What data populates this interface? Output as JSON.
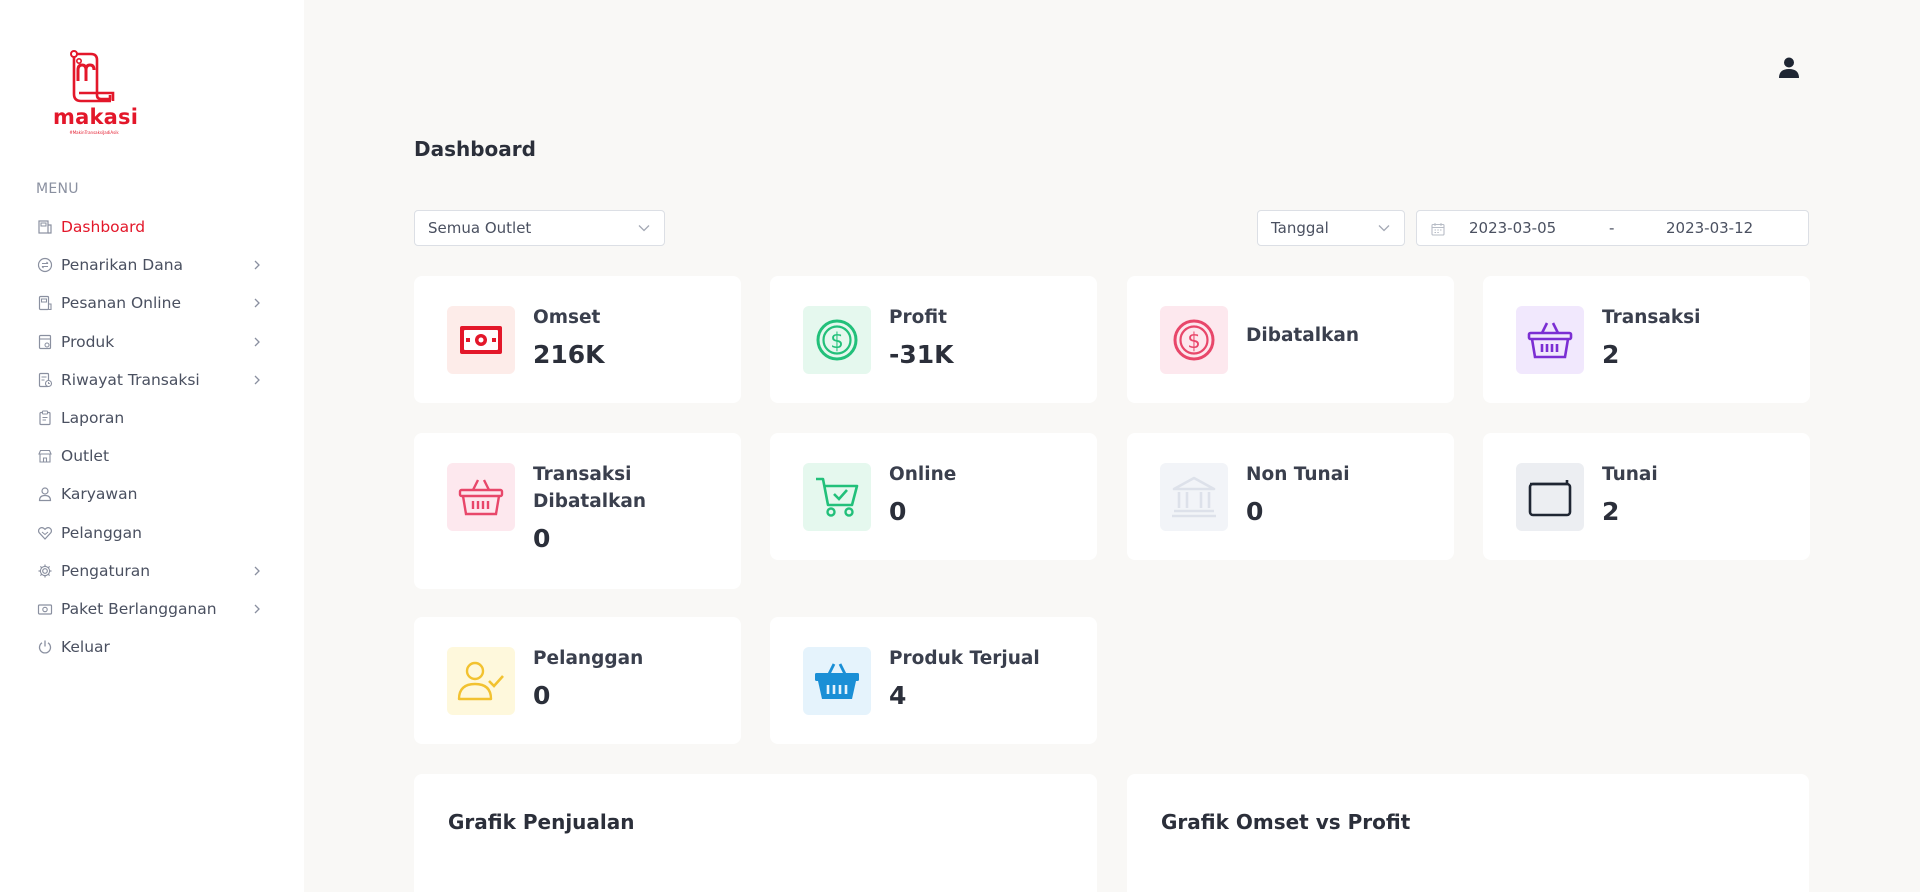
{
  "brand": {
    "name": "makasi",
    "tagline": "#MakinTransaksiJadiAsik",
    "color": "#e3172a"
  },
  "sidebar": {
    "menu_title": "MENU",
    "items": [
      {
        "label": "Dashboard",
        "icon": "dashboard-icon",
        "active": true,
        "has_submenu": false
      },
      {
        "label": "Penarikan Dana",
        "icon": "transfer-icon",
        "has_submenu": true
      },
      {
        "label": "Pesanan Online",
        "icon": "online-order-icon",
        "has_submenu": true
      },
      {
        "label": "Produk",
        "icon": "product-icon",
        "has_submenu": true
      },
      {
        "label": "Riwayat Transaksi",
        "icon": "history-icon",
        "has_submenu": true
      },
      {
        "label": "Laporan",
        "icon": "report-icon",
        "has_submenu": false
      },
      {
        "label": "Outlet",
        "icon": "store-icon",
        "has_submenu": false
      },
      {
        "label": "Karyawan",
        "icon": "employee-icon",
        "has_submenu": false
      },
      {
        "label": "Pelanggan",
        "icon": "customer-icon",
        "has_submenu": false
      },
      {
        "label": "Pengaturan",
        "icon": "settings-icon",
        "has_submenu": true
      },
      {
        "label": "Paket Berlangganan",
        "icon": "subscription-icon",
        "has_submenu": true
      },
      {
        "label": "Keluar",
        "icon": "power-icon",
        "has_submenu": false
      }
    ]
  },
  "header": {
    "title": "Dashboard",
    "user_icon": "user-icon"
  },
  "filters": {
    "outlet": "Semua Outlet",
    "period": "Tanggal",
    "date_start": "2023-03-05",
    "date_separator": "-",
    "date_end": "2023-03-12"
  },
  "stats": {
    "omset": {
      "label": "Omset",
      "value": "216K",
      "icon": "money-icon",
      "color": "#e3172a"
    },
    "profit": {
      "label": "Profit",
      "value": "-31K",
      "icon": "dollar-coin-icon",
      "color": "#22c07a"
    },
    "dibatalkan": {
      "label": "Dibatalkan",
      "icon": "dollar-coin-icon",
      "color": "#e8476a"
    },
    "transaksi": {
      "label": "Transaksi",
      "value": "2",
      "icon": "basket-icon",
      "color": "#7b2fd3"
    },
    "transaksi_dibatalkan": {
      "label_line1": "Transaksi",
      "label_line2": "Dibatalkan",
      "value": "0",
      "icon": "basket-icon",
      "color": "#e8476a"
    },
    "online": {
      "label": "Online",
      "value": "0",
      "icon": "cart-icon",
      "color": "#22c07a"
    },
    "non_tunai": {
      "label": "Non Tunai",
      "value": "0",
      "icon": "bank-icon",
      "color": "#dde1ea"
    },
    "tunai": {
      "label": "Tunai",
      "value": "2",
      "icon": "wallet-icon",
      "color": "#1f2633"
    },
    "pelanggan": {
      "label": "Pelanggan",
      "value": "0",
      "icon": "user-check-icon",
      "color": "#f2c230"
    },
    "produk_terjual": {
      "label": "Produk Terjual",
      "value": "4",
      "icon": "basket-icon",
      "color": "#1a8fd6"
    }
  },
  "panels": {
    "sales_chart_title": "Grafik Penjualan",
    "omset_profit_chart_title": "Grafik Omset vs Profit"
  }
}
